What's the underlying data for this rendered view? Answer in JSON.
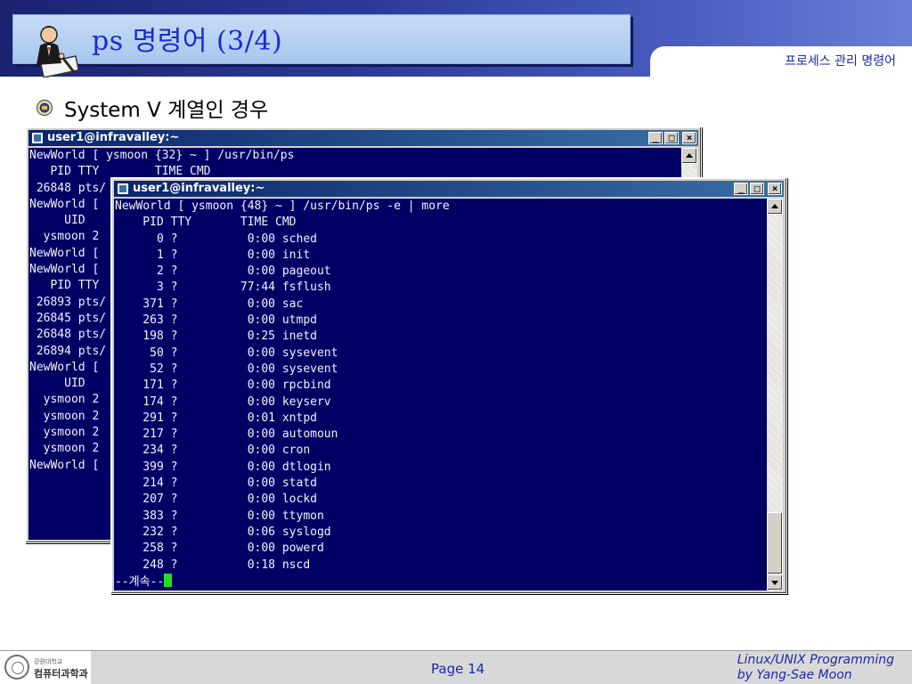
{
  "header": {
    "title": "ps 명령어 (3/4)",
    "subtitle": "프로세스 관리 명령어"
  },
  "bullet": {
    "text": "System V 계열인 경우"
  },
  "window_back": {
    "title": "user1@infravalley:~",
    "lines": [
      "NewWorld [ ysmoon {32} ~ ] /usr/bin/ps",
      "   PID TTY        TIME CMD",
      " 26848 pts/",
      "NewWorld [",
      "     UID",
      "  ysmoon 2",
      "NewWorld [",
      "NewWorld [",
      "   PID TTY",
      " 26893 pts/",
      " 26845 pts/",
      " 26848 pts/",
      " 26894 pts/",
      "NewWorld [",
      "     UID",
      "  ysmoon 2",
      "  ysmoon 2",
      "  ysmoon 2",
      "  ysmoon 2",
      "NewWorld ["
    ]
  },
  "window_front": {
    "title": "user1@infravalley:~",
    "command_line": "NewWorld [ ysmoon {48} ~ ] /usr/bin/ps -e | more",
    "header_line": "    PID TTY       TIME CMD",
    "rows": [
      {
        "pid": "0",
        "tty": "?",
        "time": "0:00",
        "cmd": "sched"
      },
      {
        "pid": "1",
        "tty": "?",
        "time": "0:00",
        "cmd": "init"
      },
      {
        "pid": "2",
        "tty": "?",
        "time": "0:00",
        "cmd": "pageout"
      },
      {
        "pid": "3",
        "tty": "?",
        "time": "77:44",
        "cmd": "fsflush"
      },
      {
        "pid": "371",
        "tty": "?",
        "time": "0:00",
        "cmd": "sac"
      },
      {
        "pid": "263",
        "tty": "?",
        "time": "0:00",
        "cmd": "utmpd"
      },
      {
        "pid": "198",
        "tty": "?",
        "time": "0:25",
        "cmd": "inetd"
      },
      {
        "pid": "50",
        "tty": "?",
        "time": "0:00",
        "cmd": "sysevent"
      },
      {
        "pid": "52",
        "tty": "?",
        "time": "0:00",
        "cmd": "sysevent"
      },
      {
        "pid": "171",
        "tty": "?",
        "time": "0:00",
        "cmd": "rpcbind"
      },
      {
        "pid": "174",
        "tty": "?",
        "time": "0:00",
        "cmd": "keyserv"
      },
      {
        "pid": "291",
        "tty": "?",
        "time": "0:01",
        "cmd": "xntpd"
      },
      {
        "pid": "217",
        "tty": "?",
        "time": "0:00",
        "cmd": "automoun"
      },
      {
        "pid": "234",
        "tty": "?",
        "time": "0:00",
        "cmd": "cron"
      },
      {
        "pid": "399",
        "tty": "?",
        "time": "0:00",
        "cmd": "dtlogin"
      },
      {
        "pid": "214",
        "tty": "?",
        "time": "0:00",
        "cmd": "statd"
      },
      {
        "pid": "207",
        "tty": "?",
        "time": "0:00",
        "cmd": "lockd"
      },
      {
        "pid": "383",
        "tty": "?",
        "time": "0:00",
        "cmd": "ttymon"
      },
      {
        "pid": "232",
        "tty": "?",
        "time": "0:06",
        "cmd": "syslogd"
      },
      {
        "pid": "258",
        "tty": "?",
        "time": "0:00",
        "cmd": "powerd"
      },
      {
        "pid": "248",
        "tty": "?",
        "time": "0:18",
        "cmd": "nscd"
      }
    ],
    "more_prompt": "--계속--"
  },
  "window_buttons": {
    "minimize": "_",
    "maximize": "□",
    "close": "×"
  },
  "icons": {
    "title_icon": "person-writing-icon",
    "bullet_icon": "bullet-seal-icon",
    "terminal_icon": "terminal-window-icon",
    "footer_logo": "university-seal-icon"
  },
  "colors": {
    "header_band": "#2b3a9a",
    "title_text": "#1c2ad0",
    "terminal_bg": "#000064",
    "terminal_fg": "#f2f2ff",
    "cursor": "#22e022"
  },
  "footer": {
    "logo_line1": "강원대학교",
    "logo_line2": "컴퓨터과학과",
    "page": "Page 14",
    "credit_line1": "Linux/UNIX Programming",
    "credit_line2": "by Yang-Sae Moon"
  }
}
